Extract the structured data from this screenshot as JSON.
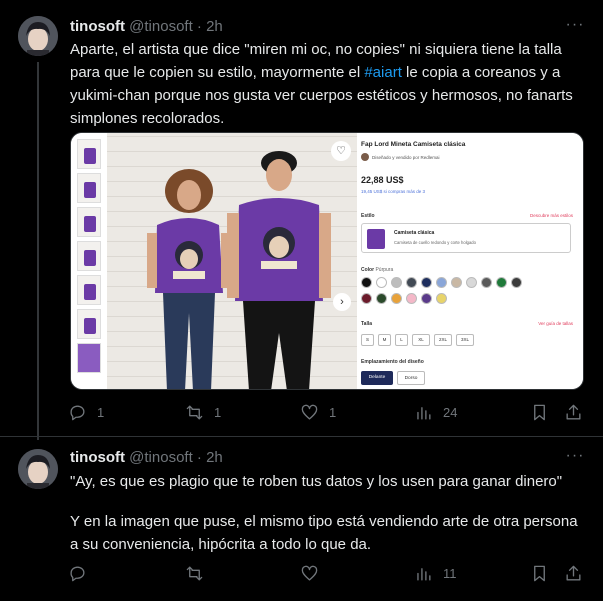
{
  "tweets": [
    {
      "author": {
        "name": "tinosoft",
        "handle": "@tinosoft",
        "time": "2h"
      },
      "text_before_hashtag": "Aparte, el artista que dice \"miren mi oc, no copies\" ni siquiera tiene la talla para que le copien su estilo, mayormente el ",
      "hashtag": "#aiart",
      "text_after_hashtag": " le copia a coreanos y a yukimi-chan porque nos gusta ver cuerpos estéticos y hermosos, no fanarts simplones recolorados.",
      "stats": {
        "replies": "1",
        "reposts": "1",
        "likes": "1",
        "views": "24"
      }
    },
    {
      "author": {
        "name": "tinosoft",
        "handle": "@tinosoft",
        "time": "2h"
      },
      "line1": "\"Ay, es que es plagio que te roben tus datos y los usen para ganar dinero\"",
      "line2": "Y en la imagen que puse, el mismo tipo está vendiendo arte de otra persona a su conveniencia, hipócrita a todo lo que da.",
      "stats": {
        "replies": "",
        "reposts": "",
        "likes": "",
        "views": "11"
      }
    }
  ],
  "product": {
    "title": "Fap Lord Mineta Camiseta clásica",
    "seller": "Diseñado y vendido por Redlemai",
    "price": "22,88 US$",
    "subprice": "19,45 US$ si compras más de 3",
    "style_label": "Estilo",
    "style_link": "Descubre más estilos",
    "style_name": "Camiseta clásica",
    "style_desc": "Camiseta de cuello redondo y corte holgado",
    "color_label": "Color",
    "color_value": "Púrpura",
    "size_label": "Talla",
    "size_link": "Ver guía de tallas",
    "sizes": [
      "S",
      "M",
      "L",
      "XL",
      "2XL",
      "3XL"
    ],
    "placement_label": "Emplazamiento del diseño",
    "placements": [
      "Delante",
      "Dorso"
    ],
    "swatch_colors": [
      "#111111",
      "#ffffff",
      "#bdbdbd",
      "#424a55",
      "#1e2e5e",
      "#8aa6d8",
      "#c9b8a4",
      "#d8d8d8",
      "#5a5a5a",
      "#1f7a3a",
      "#3b3b3b",
      "#6b1b2b",
      "#2b4a2b",
      "#e8a23a",
      "#f4b8c8",
      "#5a3a8a",
      "#e8d46a"
    ]
  },
  "colors": {
    "accent": "#1d9bf0",
    "muted": "#71767b",
    "text": "#e7e9ea",
    "bg": "#000000",
    "shirt": "#6b3aa6"
  }
}
